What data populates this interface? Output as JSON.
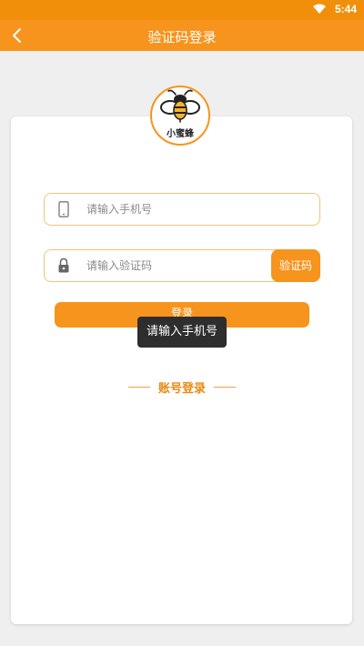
{
  "status_bar": {
    "time": "5:44",
    "wifi_icon": "wifi-icon"
  },
  "header": {
    "title": "验证码登录",
    "back_icon": "chevron-left-icon"
  },
  "logo": {
    "name": "小蜜蜂",
    "icon": "bee-icon"
  },
  "form": {
    "phone": {
      "icon": "phone-icon",
      "placeholder": "请输入手机号",
      "value": ""
    },
    "code": {
      "icon": "lock-icon",
      "placeholder": "请输入验证码",
      "value": "",
      "send_button": "验证码"
    },
    "login_button": "登录"
  },
  "toast": "请输入手机号",
  "account_login": "账号登录",
  "colors": {
    "accent": "#f7941d",
    "status_bar": "#f28f0a",
    "border": "#f3c27b",
    "background": "#efefef",
    "toast": "#2e2e2e"
  }
}
